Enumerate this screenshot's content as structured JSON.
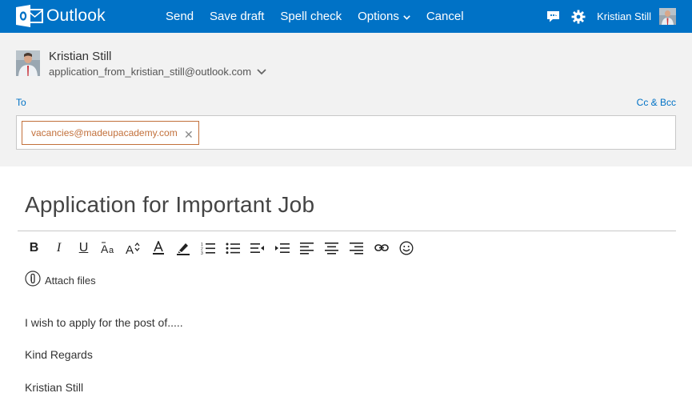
{
  "app": {
    "name": "Outlook"
  },
  "nav": {
    "send": "Send",
    "save_draft": "Save draft",
    "spell_check": "Spell check",
    "options": "Options",
    "cancel": "Cancel"
  },
  "user": {
    "name": "Kristian Still"
  },
  "from": {
    "name": "Kristian Still",
    "email": "application_from_kristian_still@outlook.com"
  },
  "to": {
    "label": "To",
    "cc_bcc": "Cc & Bcc",
    "recipients": [
      "vacancies@madeupacademy.com"
    ]
  },
  "subject": "Application for Important Job",
  "toolbar": {
    "bold": "B",
    "italic": "I",
    "underline": "U"
  },
  "attach_label": "Attach files",
  "body": {
    "lines": [
      "I wish to apply for the post of.....",
      "Kind Regards",
      "Kristian Still"
    ]
  },
  "colors": {
    "brand": "#0072c6",
    "header_bg": "#f2f2f2",
    "recipient": "#c2703b"
  },
  "icons": [
    "outlook-logo-icon",
    "feedback-icon",
    "gear-icon",
    "chevron-down-icon",
    "close-icon",
    "paperclip-icon",
    "emoticon-icon",
    "link-icon"
  ]
}
